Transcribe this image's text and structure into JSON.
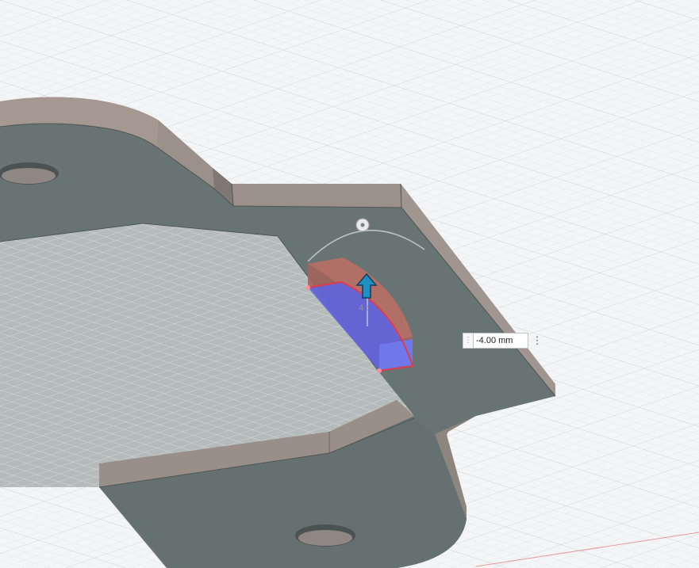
{
  "viewport": {
    "background": "#f4f5f6",
    "grid_color": "#d5d8dc",
    "part_top_color": "#667371",
    "part_side_color": "#8a817b",
    "selection_face_color": "#5a64e6",
    "preview_color": "#c0504d",
    "axis_color": "#e07070"
  },
  "manipulator": {
    "arrow_icon": "arrow-up-icon",
    "arrow_color": "#1f8fc4",
    "rotation_handle_icon": "circle-dot-icon",
    "preview_label": "4 t"
  },
  "dimension_input": {
    "value": "-4.00 mm",
    "handle_icon": "grip-icon",
    "handle_glyph": "⋮",
    "menu_icon": "more-vertical-icon",
    "menu_glyph": "⋮"
  }
}
